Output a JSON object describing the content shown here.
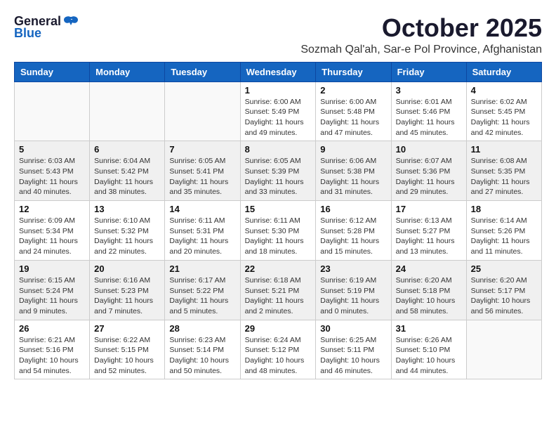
{
  "logo": {
    "general": "General",
    "blue": "Blue"
  },
  "header": {
    "month": "October 2025",
    "subtitle": "Sozmah Qal'ah, Sar-e Pol Province, Afghanistan"
  },
  "weekdays": [
    "Sunday",
    "Monday",
    "Tuesday",
    "Wednesday",
    "Thursday",
    "Friday",
    "Saturday"
  ],
  "weeks": [
    [
      {
        "day": "",
        "info": "",
        "empty": true
      },
      {
        "day": "",
        "info": "",
        "empty": true
      },
      {
        "day": "",
        "info": "",
        "empty": true
      },
      {
        "day": "1",
        "info": "Sunrise: 6:00 AM\nSunset: 5:49 PM\nDaylight: 11 hours and 49 minutes."
      },
      {
        "day": "2",
        "info": "Sunrise: 6:00 AM\nSunset: 5:48 PM\nDaylight: 11 hours and 47 minutes."
      },
      {
        "day": "3",
        "info": "Sunrise: 6:01 AM\nSunset: 5:46 PM\nDaylight: 11 hours and 45 minutes."
      },
      {
        "day": "4",
        "info": "Sunrise: 6:02 AM\nSunset: 5:45 PM\nDaylight: 11 hours and 42 minutes."
      }
    ],
    [
      {
        "day": "5",
        "info": "Sunrise: 6:03 AM\nSunset: 5:43 PM\nDaylight: 11 hours and 40 minutes.",
        "shaded": true
      },
      {
        "day": "6",
        "info": "Sunrise: 6:04 AM\nSunset: 5:42 PM\nDaylight: 11 hours and 38 minutes.",
        "shaded": true
      },
      {
        "day": "7",
        "info": "Sunrise: 6:05 AM\nSunset: 5:41 PM\nDaylight: 11 hours and 35 minutes.",
        "shaded": true
      },
      {
        "day": "8",
        "info": "Sunrise: 6:05 AM\nSunset: 5:39 PM\nDaylight: 11 hours and 33 minutes.",
        "shaded": true
      },
      {
        "day": "9",
        "info": "Sunrise: 6:06 AM\nSunset: 5:38 PM\nDaylight: 11 hours and 31 minutes.",
        "shaded": true
      },
      {
        "day": "10",
        "info": "Sunrise: 6:07 AM\nSunset: 5:36 PM\nDaylight: 11 hours and 29 minutes.",
        "shaded": true
      },
      {
        "day": "11",
        "info": "Sunrise: 6:08 AM\nSunset: 5:35 PM\nDaylight: 11 hours and 27 minutes.",
        "shaded": true
      }
    ],
    [
      {
        "day": "12",
        "info": "Sunrise: 6:09 AM\nSunset: 5:34 PM\nDaylight: 11 hours and 24 minutes."
      },
      {
        "day": "13",
        "info": "Sunrise: 6:10 AM\nSunset: 5:32 PM\nDaylight: 11 hours and 22 minutes."
      },
      {
        "day": "14",
        "info": "Sunrise: 6:11 AM\nSunset: 5:31 PM\nDaylight: 11 hours and 20 minutes."
      },
      {
        "day": "15",
        "info": "Sunrise: 6:11 AM\nSunset: 5:30 PM\nDaylight: 11 hours and 18 minutes."
      },
      {
        "day": "16",
        "info": "Sunrise: 6:12 AM\nSunset: 5:28 PM\nDaylight: 11 hours and 15 minutes."
      },
      {
        "day": "17",
        "info": "Sunrise: 6:13 AM\nSunset: 5:27 PM\nDaylight: 11 hours and 13 minutes."
      },
      {
        "day": "18",
        "info": "Sunrise: 6:14 AM\nSunset: 5:26 PM\nDaylight: 11 hours and 11 minutes."
      }
    ],
    [
      {
        "day": "19",
        "info": "Sunrise: 6:15 AM\nSunset: 5:24 PM\nDaylight: 11 hours and 9 minutes.",
        "shaded": true
      },
      {
        "day": "20",
        "info": "Sunrise: 6:16 AM\nSunset: 5:23 PM\nDaylight: 11 hours and 7 minutes.",
        "shaded": true
      },
      {
        "day": "21",
        "info": "Sunrise: 6:17 AM\nSunset: 5:22 PM\nDaylight: 11 hours and 5 minutes.",
        "shaded": true
      },
      {
        "day": "22",
        "info": "Sunrise: 6:18 AM\nSunset: 5:21 PM\nDaylight: 11 hours and 2 minutes.",
        "shaded": true
      },
      {
        "day": "23",
        "info": "Sunrise: 6:19 AM\nSunset: 5:19 PM\nDaylight: 11 hours and 0 minutes.",
        "shaded": true
      },
      {
        "day": "24",
        "info": "Sunrise: 6:20 AM\nSunset: 5:18 PM\nDaylight: 10 hours and 58 minutes.",
        "shaded": true
      },
      {
        "day": "25",
        "info": "Sunrise: 6:20 AM\nSunset: 5:17 PM\nDaylight: 10 hours and 56 minutes.",
        "shaded": true
      }
    ],
    [
      {
        "day": "26",
        "info": "Sunrise: 6:21 AM\nSunset: 5:16 PM\nDaylight: 10 hours and 54 minutes."
      },
      {
        "day": "27",
        "info": "Sunrise: 6:22 AM\nSunset: 5:15 PM\nDaylight: 10 hours and 52 minutes."
      },
      {
        "day": "28",
        "info": "Sunrise: 6:23 AM\nSunset: 5:14 PM\nDaylight: 10 hours and 50 minutes."
      },
      {
        "day": "29",
        "info": "Sunrise: 6:24 AM\nSunset: 5:12 PM\nDaylight: 10 hours and 48 minutes."
      },
      {
        "day": "30",
        "info": "Sunrise: 6:25 AM\nSunset: 5:11 PM\nDaylight: 10 hours and 46 minutes."
      },
      {
        "day": "31",
        "info": "Sunrise: 6:26 AM\nSunset: 5:10 PM\nDaylight: 10 hours and 44 minutes."
      },
      {
        "day": "",
        "info": "",
        "empty": true
      }
    ]
  ]
}
